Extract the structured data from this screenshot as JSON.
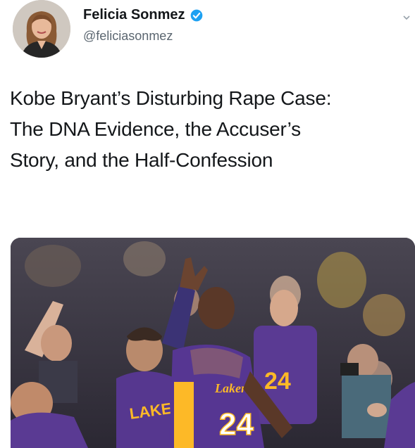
{
  "author": {
    "name": "Felicia Sonmez",
    "handle": "@feliciasonmez",
    "verified": true,
    "avatar_icon": "profile-photo"
  },
  "tweet": {
    "lines": [
      "Kobe Bryant’s Disturbing Rape Case:",
      "The DNA Evidence, the Accuser’s",
      "Story, and the Half-Confession"
    ]
  },
  "media": {
    "jersey_number": "24",
    "jersey_text": "Lakers",
    "teammate_jersey_text": "LAKE",
    "fan_jersey_number": "24"
  },
  "colors": {
    "verified_blue": "#1da1f2",
    "lakers_purple": "#552583",
    "lakers_gold": "#fdb927"
  }
}
